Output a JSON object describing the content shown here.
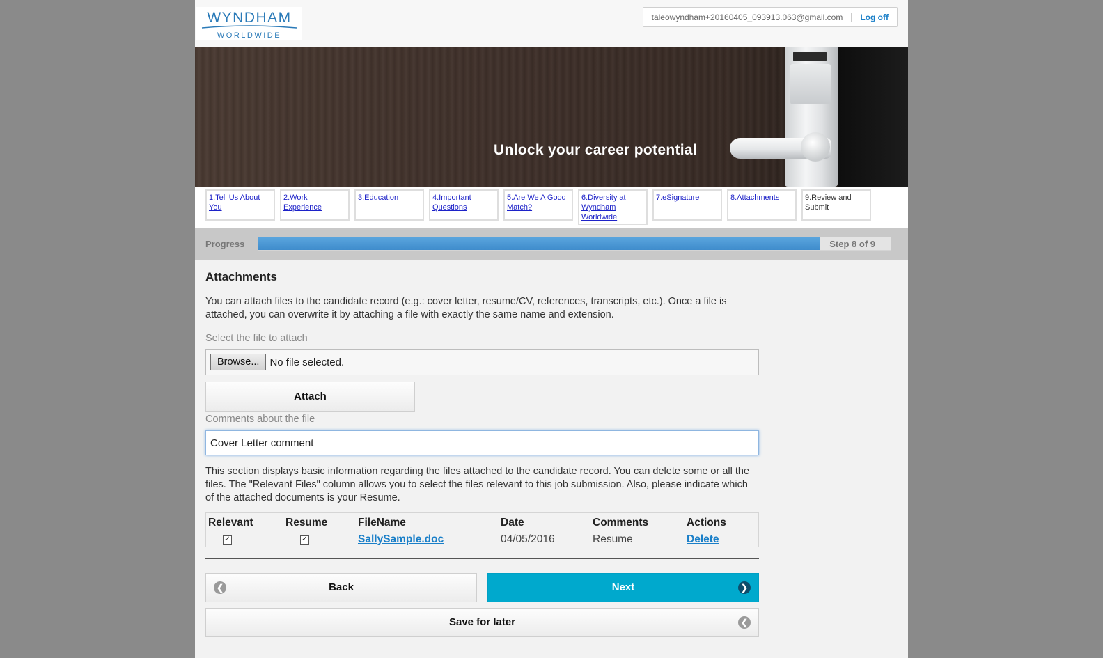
{
  "header": {
    "logo_main": "WYNDHAM",
    "logo_sub": "WORLDWIDE",
    "user_email": "taleowyndham+20160405_093913.063@gmail.com",
    "logoff_label": "Log off"
  },
  "banner": {
    "tagline": "Unlock your career potential"
  },
  "steps": [
    {
      "label": "1.Tell Us About You",
      "link": true
    },
    {
      "label": "2.Work Experience",
      "link": true
    },
    {
      "label": "3.Education",
      "link": true
    },
    {
      "label": "4.Important Questions",
      "link": true
    },
    {
      "label": "5.Are We A Good Match?",
      "link": true
    },
    {
      "label": "6.Diversity at Wyndham Worldwide",
      "link": true
    },
    {
      "label": "7.eSignature",
      "link": true
    },
    {
      "label": "8.Attachments",
      "link": true
    },
    {
      "label": "9.Review and Submit",
      "link": false
    }
  ],
  "progress": {
    "label": "Progress",
    "step_text": "Step 8 of 9",
    "current": 8,
    "total": 9,
    "accent": "#4a96d4"
  },
  "attachments": {
    "title": "Attachments",
    "intro": "You can attach files to the candidate record (e.g.: cover letter, resume/CV, references, transcripts, etc.). Once a file is attached, you can overwrite it by attaching a file with exactly the same name and extension.",
    "select_label": "Select the file to attach",
    "browse_label": "Browse...",
    "file_status": "No file selected.",
    "attach_label": "Attach",
    "comments_label": "Comments about the file",
    "comments_value": "Cover Letter comment",
    "files_desc": "This section displays basic information regarding the files attached to the candidate record. You can delete some or all the files. The \"Relevant Files\" column allows you to select the files relevant to this job submission. Also, please indicate which of the attached documents is your Resume."
  },
  "table": {
    "headers": {
      "relevant": "Relevant",
      "resume": "Resume",
      "filename": "FileName",
      "date": "Date",
      "comments": "Comments",
      "actions": "Actions"
    },
    "row": {
      "relevant_checked": true,
      "resume_checked": true,
      "filename": "SallySample.doc",
      "date": "04/05/2016",
      "comments": "Resume",
      "action": "Delete"
    }
  },
  "buttons": {
    "back": "Back",
    "next": "Next",
    "save": "Save for later"
  },
  "colors": {
    "next_button": "#00a9cd",
    "link": "#1a7fc8",
    "step_link": "#1d22c8"
  }
}
